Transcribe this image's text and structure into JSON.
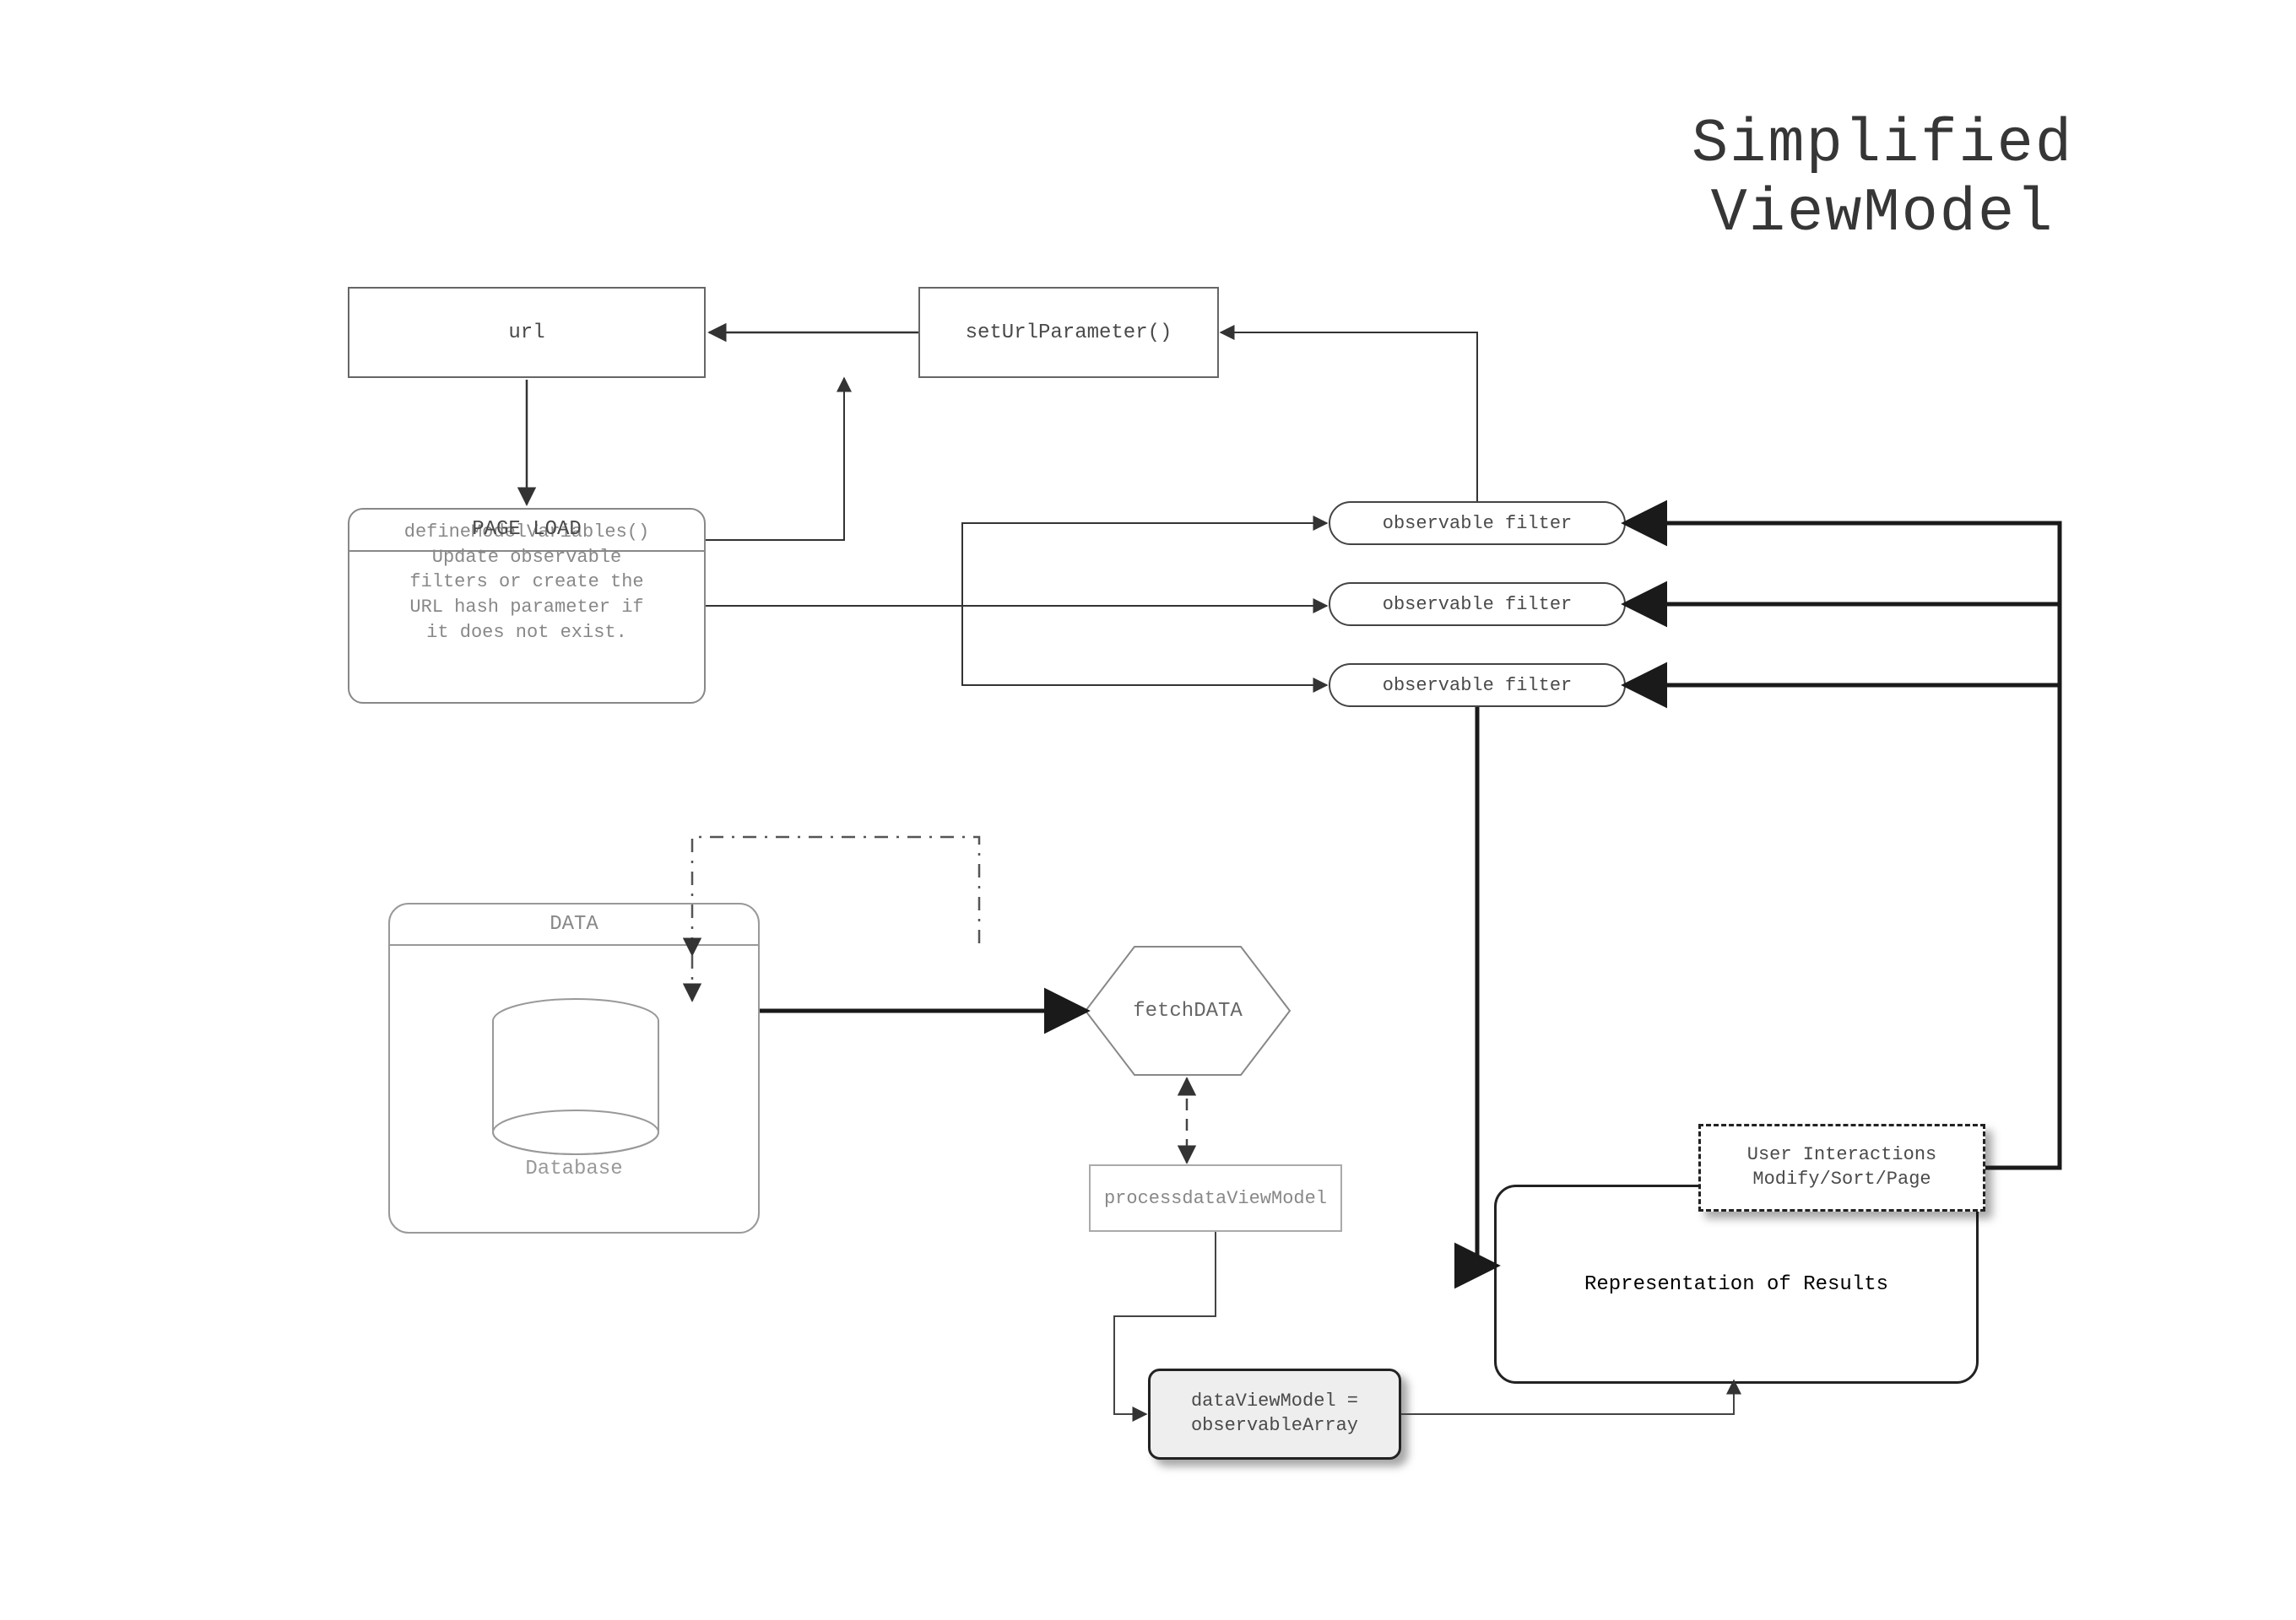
{
  "title": {
    "line1": "Simplified",
    "line2": "ViewModel"
  },
  "nodes": {
    "url": "url",
    "setUrlParameter": "setUrlParameter()",
    "pageLoad": {
      "title": "PAGE LOAD",
      "body": "defineModelVariables()\nUpdate observable\nfilters or create the\nURL hash parameter if\nit does not exist."
    },
    "filters": [
      "observable filter",
      "observable filter",
      "observable filter"
    ],
    "data": {
      "title": "DATA",
      "db": "Database"
    },
    "fetchData": "fetchDATA",
    "processDataViewModel": "processdataViewModel",
    "dataViewModel": "dataViewModel =\nobservableArray",
    "results": "Representation of Results",
    "userInteractions": "User Interactions\nModify/Sort/Page"
  }
}
